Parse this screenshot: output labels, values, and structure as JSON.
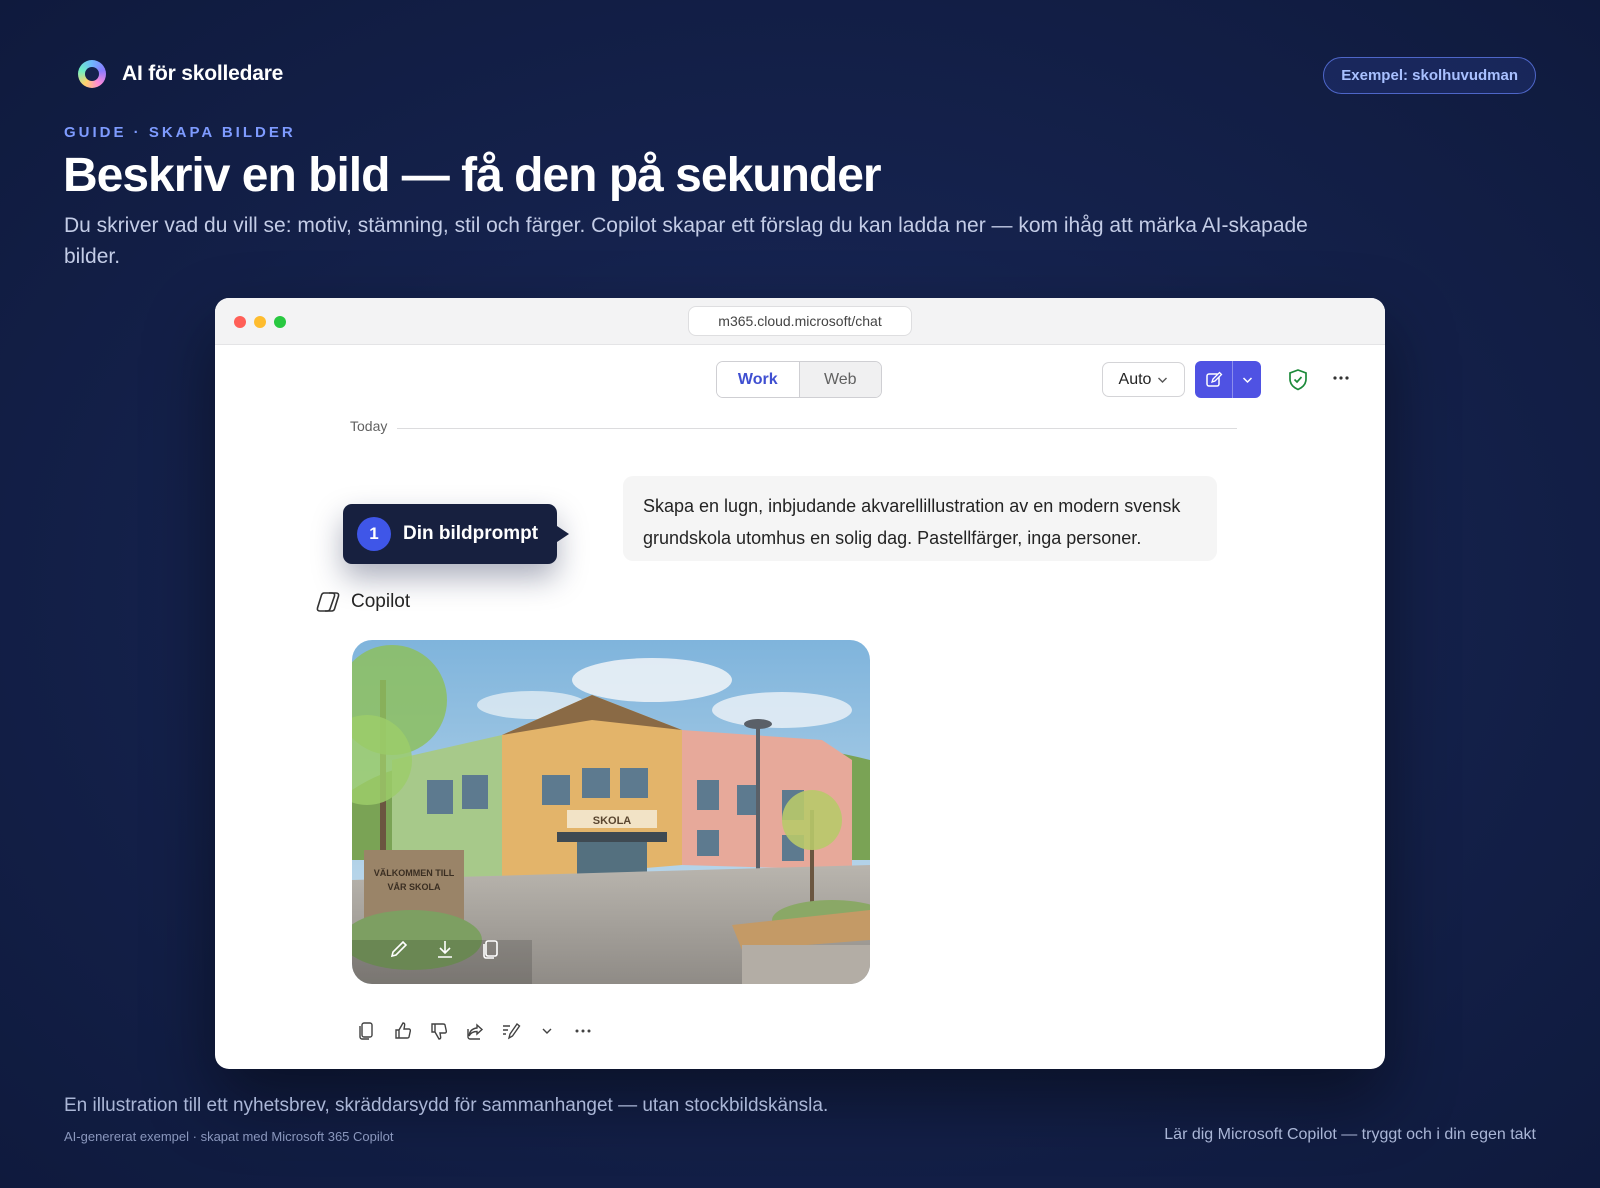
{
  "brand": {
    "name": "AI för skolledare",
    "icon": "ring-logo-icon"
  },
  "pill": {
    "label": "Exempel: skolhuvudman"
  },
  "hero": {
    "eyebrow": "GUIDE · SKAPA BILDER",
    "title": "Beskriv en bild — få den på sekunder",
    "subtitle": "Du skriver vad du vill se: motiv, stämning, stil och färger. Copilot skapar ett förslag du kan ladda ner — kom ihåg att märka AI-skapade bilder."
  },
  "browser": {
    "url": "m365.cloud.microsoft/chat"
  },
  "chat": {
    "toggle": {
      "work": "Work",
      "web": "Web",
      "active": "Work"
    },
    "model": "Auto",
    "divider": "Today",
    "user_prompt": "Skapa en lugn, inbjudande akvarellillustration av en modern svensk grundskola utomhus en solig dag. Pastellfärger, inga personer.",
    "callout": {
      "number": "1",
      "label": "Din bildprompt"
    },
    "assistant_name": "Copilot",
    "image": {
      "sign": "SKOLA",
      "welcome_line1": "VÄLKOMMEN TILL",
      "welcome_line2": "VÅR SKOLA"
    }
  },
  "footer": {
    "caption": "En illustration till ett nyhetsbrev, skräddarsydd för sammanhanget — utan stockbildskänsla.",
    "credit": "AI-genererat exempel · skapat med Microsoft 365 Copilot",
    "tagline": "Lär dig Microsoft Copilot — tryggt och i din egen takt"
  },
  "colors": {
    "accent": "#4f52e3",
    "callout_bg": "#17203f",
    "eyebrow": "#7e9bff",
    "background": "#15224d"
  }
}
